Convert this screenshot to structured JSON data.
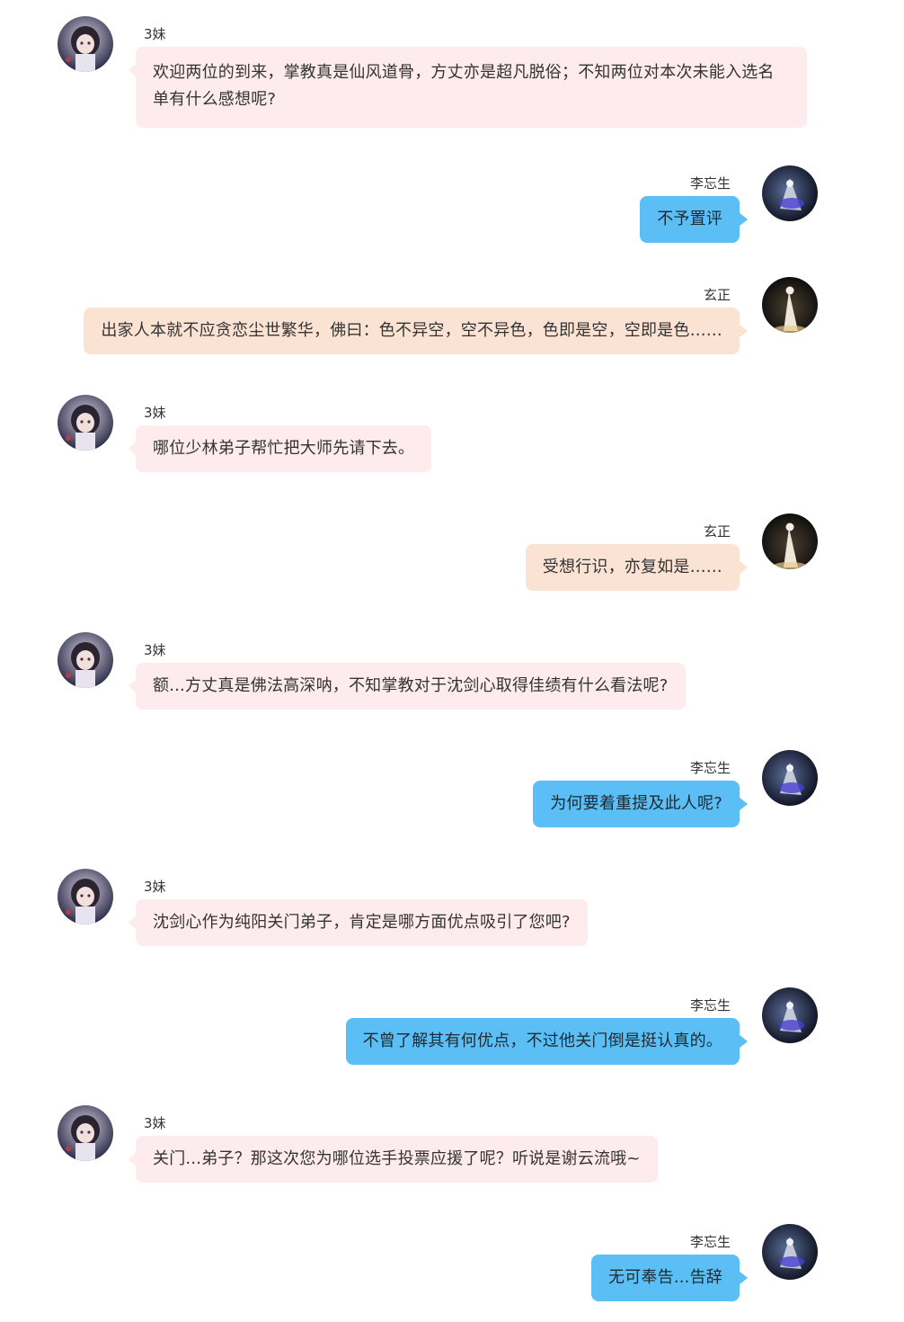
{
  "conversation": [
    {
      "speaker": "3妹",
      "text": "欢迎两位的到来，掌教真是仙风道骨，方丈亦是超凡脱俗；不知两位对本次未能入选名单有什么感想呢?"
    },
    {
      "speaker": "李忘生",
      "text": "不予置评"
    },
    {
      "speaker": "玄正",
      "text": "出家人本就不应贪恋尘世繁华，佛曰：色不异空，空不异色，色即是空，空即是色……"
    },
    {
      "speaker": "3妹",
      "text": "哪位少林弟子帮忙把大师先请下去。"
    },
    {
      "speaker": "玄正",
      "text": "受想行识，亦复如是……"
    },
    {
      "speaker": "3妹",
      "text": "额...方丈真是佛法高深呐，不知掌教对于沈剑心取得佳绩有什么看法呢?"
    },
    {
      "speaker": "李忘生",
      "text": "为何要着重提及此人呢?"
    },
    {
      "speaker": "3妹",
      "text": "沈剑心作为纯阳关门弟子，肯定是哪方面优点吸引了您吧?"
    },
    {
      "speaker": "李忘生",
      "text": "不曾了解其有何优点，不过他关门倒是挺认真的。"
    },
    {
      "speaker": "3妹",
      "text": "关门...弟子？那这次您为哪位选手投票应援了呢？听说是谢云流哦~"
    },
    {
      "speaker": "李忘生",
      "text": "无可奉告...告辞"
    }
  ],
  "colors": {
    "host_bubble": "#fdebee",
    "liwangsheng_bubble": "#5bbff6",
    "xuanzheng_bubble": "#fbe3d4"
  },
  "avatars": {
    "host": "girl-avatar-icon",
    "liwangsheng": "taoist-avatar-icon",
    "xuanzheng": "monk-avatar-icon"
  }
}
